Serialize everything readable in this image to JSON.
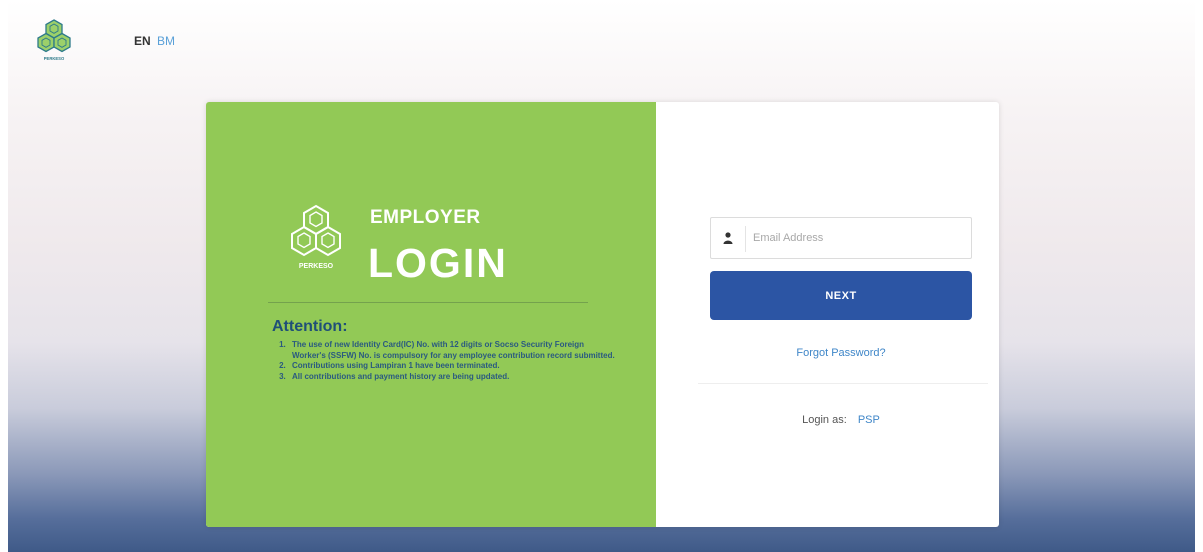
{
  "header": {
    "logo_text": "PERKESO",
    "lang_en": "EN",
    "lang_bm": "BM"
  },
  "left_panel": {
    "logo_text": "PERKESO",
    "employer": "EMPLOYER",
    "login": "LOGIN",
    "attention_title": "Attention:",
    "attention_items": [
      "The use of new Identity Card(IC) No. with 12 digits or Socso Security Foreign Worker's (SSFW) No. is compulsory for any employee contribution record submitted.",
      "Contributions using Lampiran 1 have been terminated.",
      "All contributions and payment history are being updated."
    ]
  },
  "right_panel": {
    "email_placeholder": "Email Address",
    "next_label": "NEXT",
    "forgot_password": "Forgot Password?",
    "login_as_label": "Login as:",
    "psp_link": "PSP"
  },
  "colors": {
    "green_panel": "#92c956",
    "next_button": "#2c55a4",
    "link": "#3f86c8",
    "attention_text": "#1f4f78"
  }
}
